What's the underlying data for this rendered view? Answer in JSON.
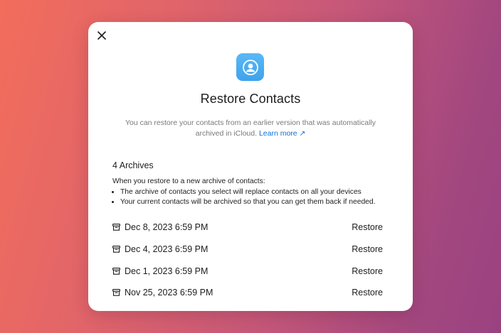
{
  "dialog": {
    "title": "Restore Contacts",
    "subtitle": "You can restore your contacts from an earlier version that was automatically archived in iCloud.",
    "learn_more": "Learn more ↗",
    "archives_count": "4 Archives",
    "info_heading": "When you restore to a new archive of contacts:",
    "info_bullets": [
      "The archive of contacts you select will replace contacts on all your devices",
      "Your current contacts will be archived so that you can get them back if needed."
    ],
    "archives": [
      {
        "date": "Dec 8, 2023 6:59 PM",
        "action": "Restore"
      },
      {
        "date": "Dec 4, 2023 6:59 PM",
        "action": "Restore"
      },
      {
        "date": "Dec 1, 2023 6:59 PM",
        "action": "Restore"
      },
      {
        "date": "Nov 25, 2023 6:59 PM",
        "action": "Restore"
      }
    ]
  },
  "icons": {
    "close": "close-icon",
    "app": "contacts-app-icon",
    "archive": "archive-box-icon"
  },
  "colors": {
    "accent_link": "#0a72d9",
    "app_icon": "#4aaef0",
    "background_start": "#f26d5b",
    "background_end": "#9a4280"
  }
}
